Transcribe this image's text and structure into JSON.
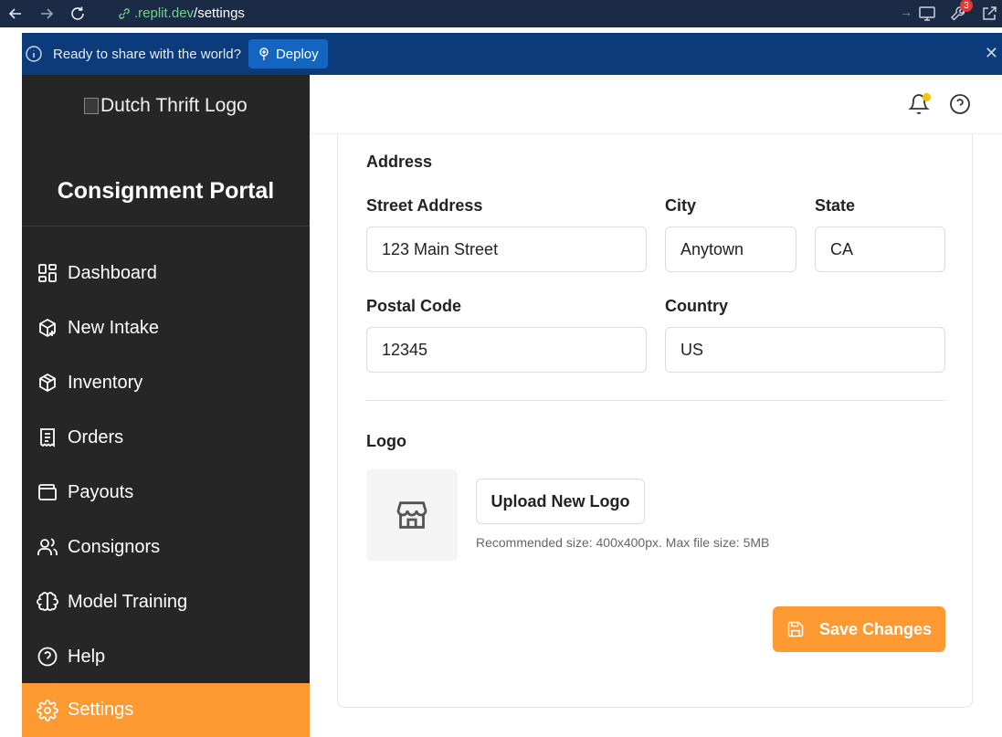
{
  "browser": {
    "url_domain": ".replit.dev",
    "url_path": "/settings",
    "notification_count": "3"
  },
  "banner": {
    "message": "Ready to share with the world?",
    "deploy_label": "Deploy"
  },
  "sidebar": {
    "logo_alt": "Dutch Thrift Logo",
    "title": "Consignment Portal",
    "items": [
      {
        "label": "Dashboard",
        "icon": "dashboard-icon"
      },
      {
        "label": "New Intake",
        "icon": "package-plus-icon"
      },
      {
        "label": "Inventory",
        "icon": "package-icon"
      },
      {
        "label": "Orders",
        "icon": "receipt-icon"
      },
      {
        "label": "Payouts",
        "icon": "wallet-icon"
      },
      {
        "label": "Consignors",
        "icon": "users-icon"
      },
      {
        "label": "Model Training",
        "icon": "brain-icon"
      },
      {
        "label": "Help",
        "icon": "help-circle-icon"
      },
      {
        "label": "Settings",
        "icon": "gear-icon",
        "active": true
      }
    ]
  },
  "form": {
    "section_address": "Address",
    "street_label": "Street Address",
    "street_value": "123 Main Street",
    "city_label": "City",
    "city_value": "Anytown",
    "state_label": "State",
    "state_value": "CA",
    "postal_label": "Postal Code",
    "postal_value": "12345",
    "country_label": "Country",
    "country_value": "US",
    "section_logo": "Logo",
    "upload_label": "Upload New Logo",
    "upload_hint": "Recommended size: 400x400px. Max file size: 5MB",
    "save_label": "Save Changes"
  },
  "colors": {
    "accent": "#ff9a33",
    "sidebar_bg": "#262626",
    "banner_bg": "#0b3b7a"
  }
}
